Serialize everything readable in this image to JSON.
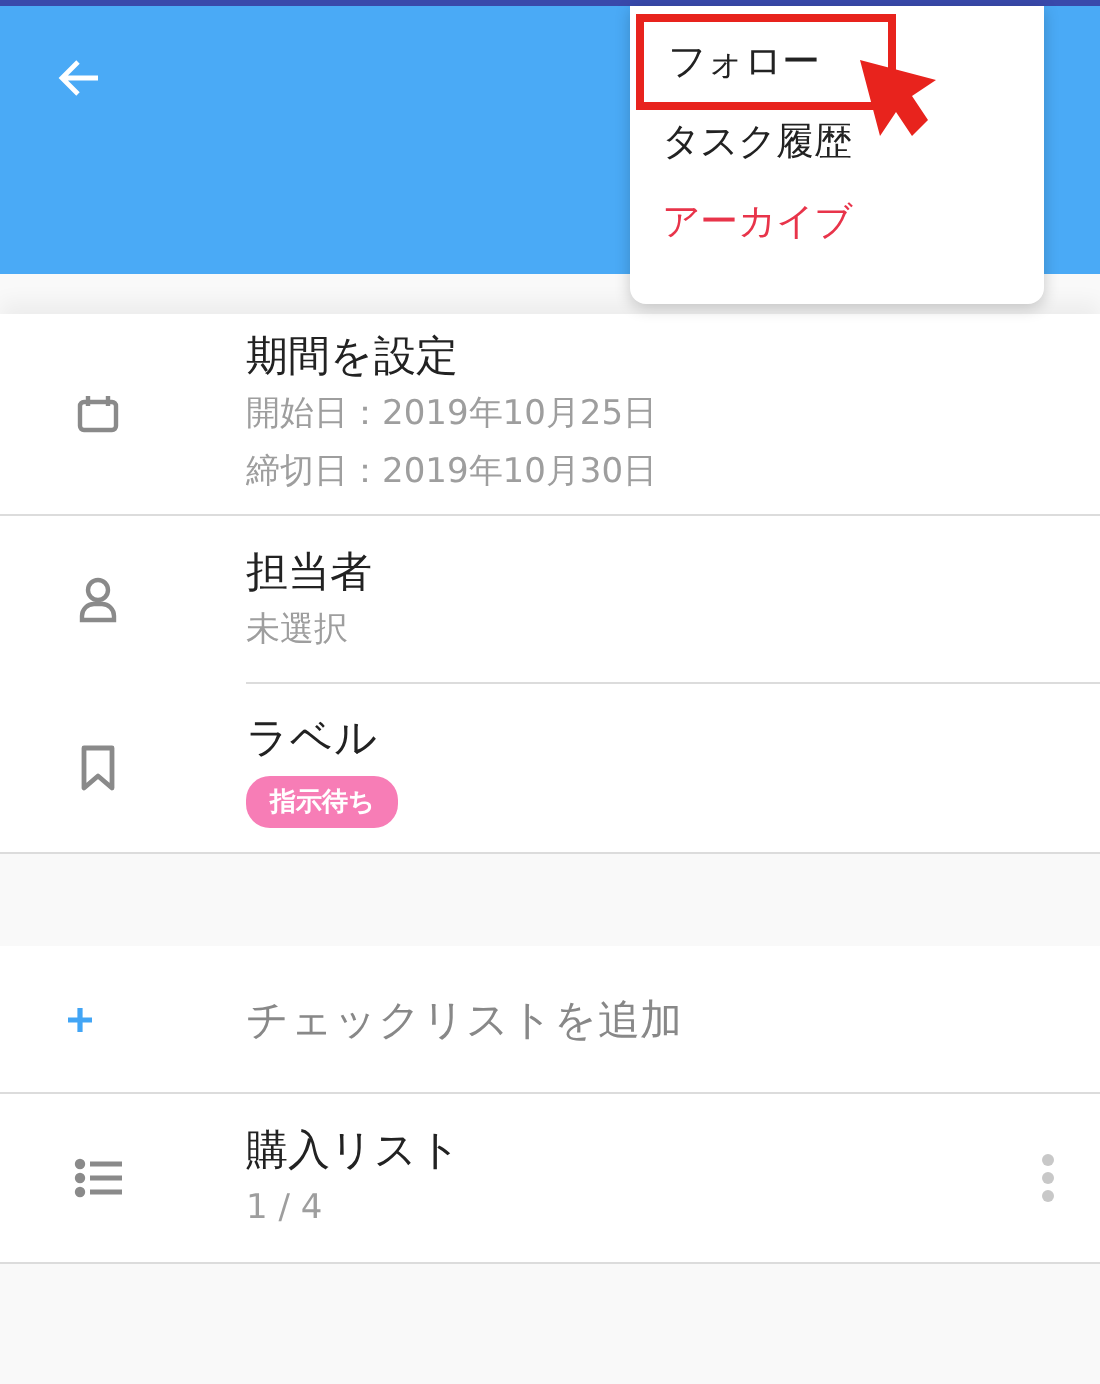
{
  "menu": {
    "items": [
      {
        "label": "フォロー",
        "kind": "normal",
        "highlighted": true
      },
      {
        "label": "タスク履歴",
        "kind": "normal",
        "highlighted": false
      },
      {
        "label": "アーカイブ",
        "kind": "danger",
        "highlighted": false
      }
    ]
  },
  "details": [
    {
      "kind": "period",
      "title": "期間を設定",
      "lines": [
        "開始日：2019年10月25日",
        "締切日：2019年10月30日"
      ]
    },
    {
      "kind": "assignee",
      "title": "担当者",
      "lines": [
        "未選択"
      ]
    },
    {
      "kind": "label",
      "title": "ラベル",
      "tags": [
        {
          "label": "指示待ち",
          "color": "#f77db6"
        }
      ]
    }
  ],
  "checklist": {
    "add_label": "チェックリストを追加",
    "lists": [
      {
        "title": "購入リスト",
        "progress": "1 / 4"
      }
    ]
  }
}
